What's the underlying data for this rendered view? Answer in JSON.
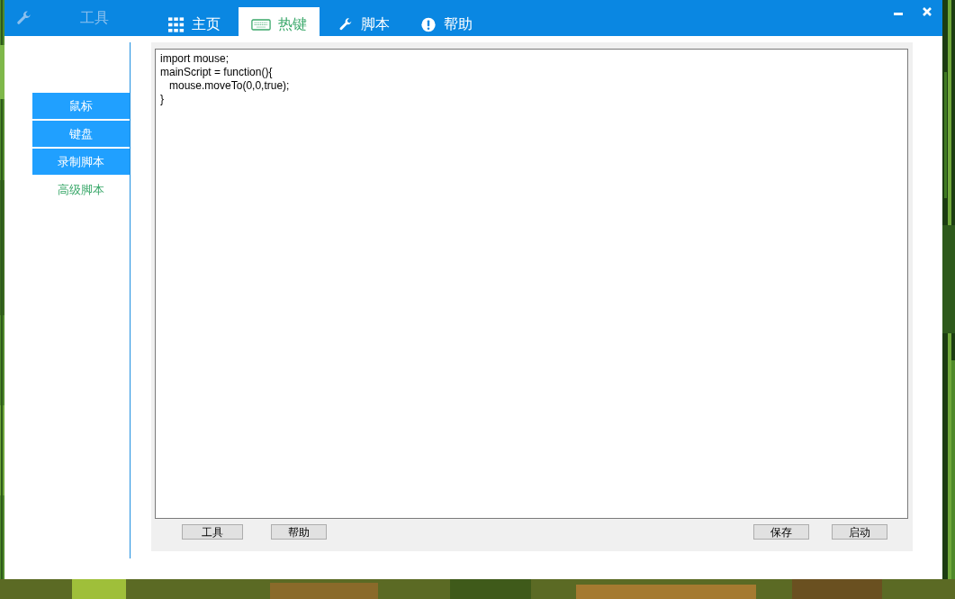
{
  "window": {
    "title": "工具"
  },
  "tabs": [
    {
      "label": "主页",
      "selected": false
    },
    {
      "label": "热键",
      "selected": true
    },
    {
      "label": "脚本",
      "selected": false
    },
    {
      "label": "帮助",
      "selected": false
    }
  ],
  "sidebar": {
    "items": [
      {
        "label": "鼠标",
        "selected": false
      },
      {
        "label": "键盘",
        "selected": false
      },
      {
        "label": "录制脚本",
        "selected": false
      },
      {
        "label": "高级脚本",
        "selected": true
      }
    ]
  },
  "editor": {
    "value": "import mouse;\nmainScript = function(){\n   mouse.moveTo(0,0,true);\n}"
  },
  "buttons_left": [
    "工具",
    "帮助"
  ],
  "buttons_right": [
    "保存",
    "启动"
  ]
}
